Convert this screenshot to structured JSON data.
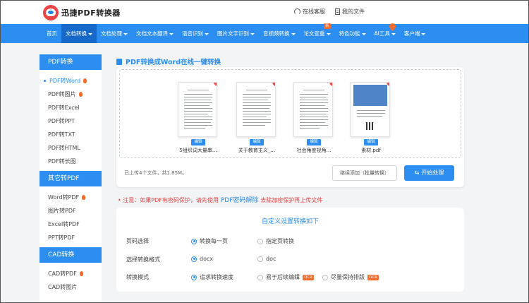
{
  "header": {
    "app_name": "迅捷PDF转换器",
    "links": [
      {
        "label": "在线客服",
        "icon": "headset-icon"
      },
      {
        "label": "我的文件",
        "icon": "document-icon"
      }
    ]
  },
  "nav": {
    "items": [
      {
        "label": "首页"
      },
      {
        "label": "文档转换"
      },
      {
        "label": "文档处理"
      },
      {
        "label": "文档文本翻译"
      },
      {
        "label": "语音识别"
      },
      {
        "label": "图片文字识别"
      },
      {
        "label": "音视频转换"
      },
      {
        "label": "论文查重",
        "badge": "新"
      },
      {
        "label": "特色功能"
      },
      {
        "label": "AI工具"
      },
      {
        "label": "客户端"
      }
    ]
  },
  "sidebar": {
    "sections": [
      {
        "title": "PDF转换",
        "items": [
          {
            "label": "PDF转Word"
          },
          {
            "label": "PDF转图片"
          },
          {
            "label": "PDF转Excel"
          },
          {
            "label": "PDF转PPT"
          },
          {
            "label": "PDF转TXT"
          },
          {
            "label": "PDF转HTML"
          },
          {
            "label": "PDF转长图"
          }
        ]
      },
      {
        "title": "其它转PDF",
        "items": [
          {
            "label": "Word转PDF"
          },
          {
            "label": "图片转PDF"
          },
          {
            "label": "Excel转PDF"
          },
          {
            "label": "PPT转PDF"
          }
        ]
      },
      {
        "title": "CAD转换",
        "items": [
          {
            "label": "CAD转PDF"
          },
          {
            "label": "CAD转图片"
          }
        ]
      }
    ]
  },
  "main": {
    "title": "PDF转换成Word在线一键转换",
    "files": [
      {
        "name": "5组织词大量串...",
        "edit_label": "编辑"
      },
      {
        "name": "关于教育主义_...",
        "edit_label": "编辑"
      },
      {
        "name": "社会角度视角...",
        "edit_label": "编辑"
      },
      {
        "name": "素材.pdf",
        "edit_label": "编辑"
      }
    ],
    "upload_status": "已上传4个文件，共1.85M。",
    "continue_label": "继续添加（批量转换）",
    "start_label": "开始处理",
    "notice_prefix": "注意：如果PDF有密码保护，请先使用",
    "notice_link": "PDF密码解除",
    "notice_suffix": "去除加密保护再上传文件"
  },
  "settings": {
    "title": "自定义设置转换如下",
    "rows": [
      {
        "label": "页码选择",
        "options": [
          "转换每一页",
          "指定页转换"
        ]
      },
      {
        "label": "选择转换格式",
        "options": [
          "docx",
          "doc"
        ]
      },
      {
        "label": "转换模式",
        "options": [
          "追求转换速度",
          "易于后续编辑",
          "尽量保持排版"
        ]
      }
    ],
    "ocr_tag": "OCR"
  },
  "colors": {
    "accent": "#2b8ef0",
    "danger": "#e94343",
    "orange": "#f46b2b"
  }
}
